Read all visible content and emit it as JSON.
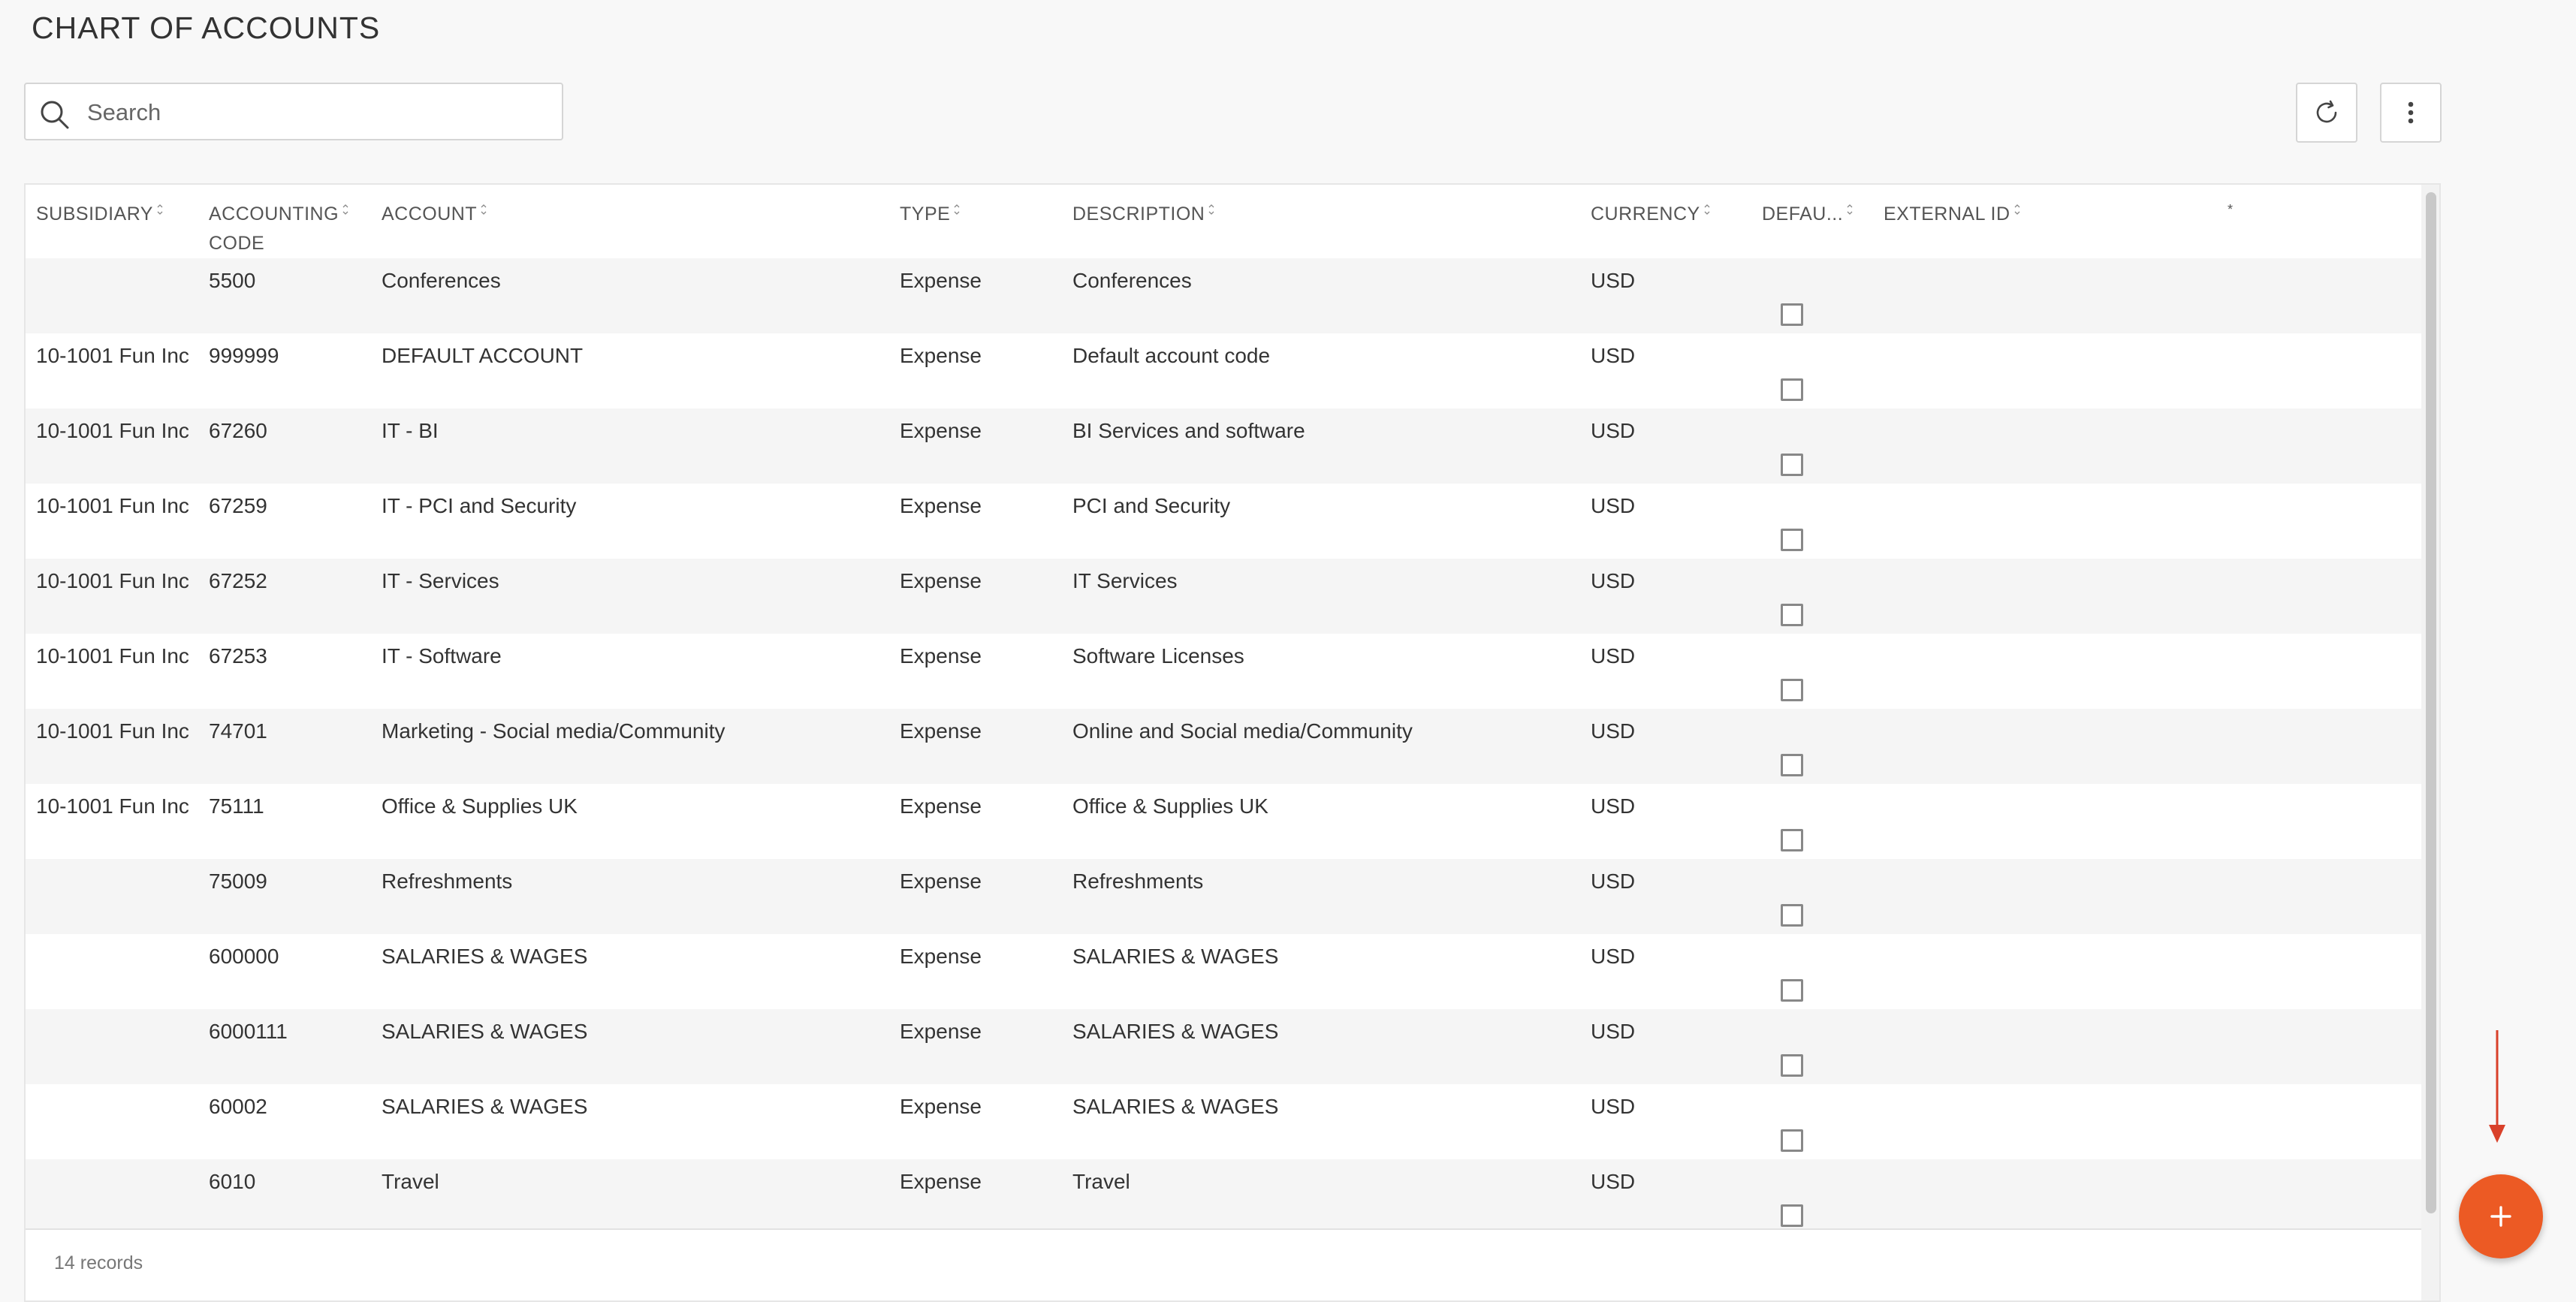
{
  "page": {
    "title": "CHART OF ACCOUNTS"
  },
  "search": {
    "placeholder": "Search",
    "value": "",
    "icon": "search-icon"
  },
  "toolbar": {
    "refresh_icon": "refresh-icon",
    "more_icon": "more-vertical-icon"
  },
  "table": {
    "columns": [
      {
        "key": "subsidiary",
        "label": "SUBSIDIARY"
      },
      {
        "key": "accounting_code",
        "label": "ACCOUNTING CODE",
        "line1": "ACCOUNTING",
        "line2": "CODE"
      },
      {
        "key": "account",
        "label": "ACCOUNT"
      },
      {
        "key": "type",
        "label": "TYPE"
      },
      {
        "key": "description",
        "label": "DESCRIPTION"
      },
      {
        "key": "currency",
        "label": "CURRENCY"
      },
      {
        "key": "default",
        "label": "DEFAU..."
      },
      {
        "key": "external_id",
        "label": "EXTERNAL ID"
      },
      {
        "key": "extra",
        "label": "*"
      }
    ],
    "rows": [
      {
        "subsidiary": "",
        "accounting_code": "5500",
        "account": "Conferences",
        "type": "Expense",
        "description": "Conferences",
        "currency": "USD",
        "default": false,
        "external_id": ""
      },
      {
        "subsidiary": "10-1001 Fun Inc",
        "accounting_code": "999999",
        "account": "DEFAULT ACCOUNT",
        "type": "Expense",
        "description": "Default account code",
        "currency": "USD",
        "default": false,
        "external_id": ""
      },
      {
        "subsidiary": "10-1001 Fun Inc",
        "accounting_code": "67260",
        "account": "IT - BI",
        "type": "Expense",
        "description": "BI Services and software",
        "currency": "USD",
        "default": false,
        "external_id": ""
      },
      {
        "subsidiary": "10-1001 Fun Inc",
        "accounting_code": "67259",
        "account": "IT - PCI and Security",
        "type": "Expense",
        "description": "PCI and Security",
        "currency": "USD",
        "default": false,
        "external_id": ""
      },
      {
        "subsidiary": "10-1001 Fun Inc",
        "accounting_code": "67252",
        "account": "IT - Services",
        "type": "Expense",
        "description": "IT Services",
        "currency": "USD",
        "default": false,
        "external_id": ""
      },
      {
        "subsidiary": "10-1001 Fun Inc",
        "accounting_code": "67253",
        "account": "IT - Software",
        "type": "Expense",
        "description": "Software Licenses",
        "currency": "USD",
        "default": false,
        "external_id": ""
      },
      {
        "subsidiary": "10-1001 Fun Inc",
        "accounting_code": "74701",
        "account": "Marketing - Social media/Community",
        "type": "Expense",
        "description": "Online and Social media/Community",
        "currency": "USD",
        "default": false,
        "external_id": ""
      },
      {
        "subsidiary": "10-1001 Fun Inc",
        "accounting_code": "75111",
        "account": "Office & Supplies UK",
        "type": "Expense",
        "description": "Office & Supplies UK",
        "currency": "USD",
        "default": false,
        "external_id": ""
      },
      {
        "subsidiary": "",
        "accounting_code": "75009",
        "account": "Refreshments",
        "type": "Expense",
        "description": "Refreshments",
        "currency": "USD",
        "default": false,
        "external_id": ""
      },
      {
        "subsidiary": "",
        "accounting_code": "600000",
        "account": "SALARIES & WAGES",
        "type": "Expense",
        "description": "SALARIES & WAGES",
        "currency": "USD",
        "default": false,
        "external_id": ""
      },
      {
        "subsidiary": "",
        "accounting_code": "6000111",
        "account": "SALARIES & WAGES",
        "type": "Expense",
        "description": "SALARIES & WAGES",
        "currency": "USD",
        "default": false,
        "external_id": ""
      },
      {
        "subsidiary": "",
        "accounting_code": "60002",
        "account": "SALARIES & WAGES",
        "type": "Expense",
        "description": "SALARIES & WAGES",
        "currency": "USD",
        "default": false,
        "external_id": ""
      },
      {
        "subsidiary": "",
        "accounting_code": "6010",
        "account": "Travel",
        "type": "Expense",
        "description": "Travel",
        "currency": "USD",
        "default": false,
        "external_id": ""
      }
    ]
  },
  "footer": {
    "records_label": "14 records"
  },
  "fab": {
    "icon": "plus-icon"
  },
  "colors": {
    "accent": "#ec5a24",
    "annotation_arrow": "#d9412a"
  }
}
